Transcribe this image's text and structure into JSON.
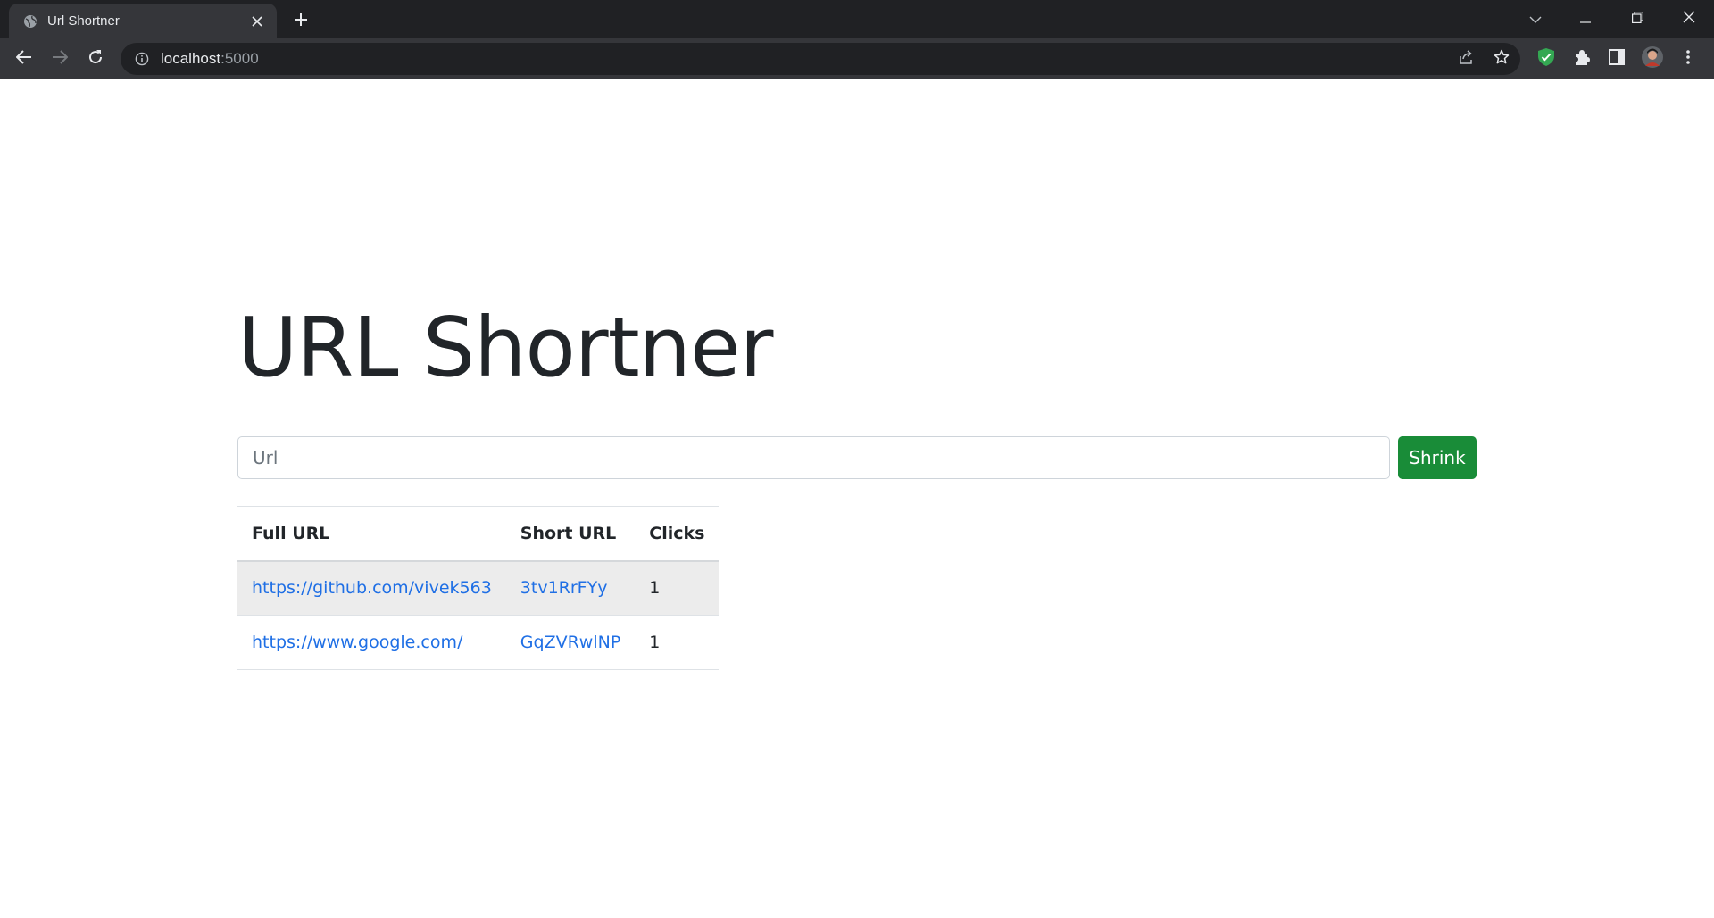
{
  "browser": {
    "tab_title": "Url Shortner",
    "address_host": "localhost",
    "address_port": ":5000",
    "icons": {
      "favicon": "globe-icon",
      "tab_close": "close-icon",
      "new_tab": "plus-icon",
      "tab_search": "chevron-down-icon",
      "minimize": "minimize-icon",
      "restore": "restore-icon",
      "close": "close-icon",
      "back": "arrow-left-icon",
      "forward": "arrow-right-icon",
      "reload": "reload-icon",
      "site_info": "info-icon",
      "share": "share-icon",
      "bookmark": "star-icon",
      "extension_shield": "shield-icon",
      "extensions": "puzzle-icon",
      "side_panel": "side-panel-icon",
      "profile": "avatar",
      "menu": "kebab-menu-icon"
    },
    "colors": {
      "shield": "#34a853"
    }
  },
  "page": {
    "heading": "URL Shortner",
    "input_placeholder": "Url",
    "button_label": "Shrink",
    "table": {
      "headers": [
        "Full URL",
        "Short URL",
        "Clicks"
      ],
      "rows": [
        {
          "full_url": "https://github.com/vivek563",
          "short_url": "3tv1RrFYy",
          "clicks": "1"
        },
        {
          "full_url": "https://www.google.com/",
          "short_url": "GqZVRwlNP",
          "clicks": "1"
        }
      ]
    },
    "colors": {
      "button": "#198c38",
      "link": "#1f6fe5",
      "heading": "#212529"
    }
  }
}
